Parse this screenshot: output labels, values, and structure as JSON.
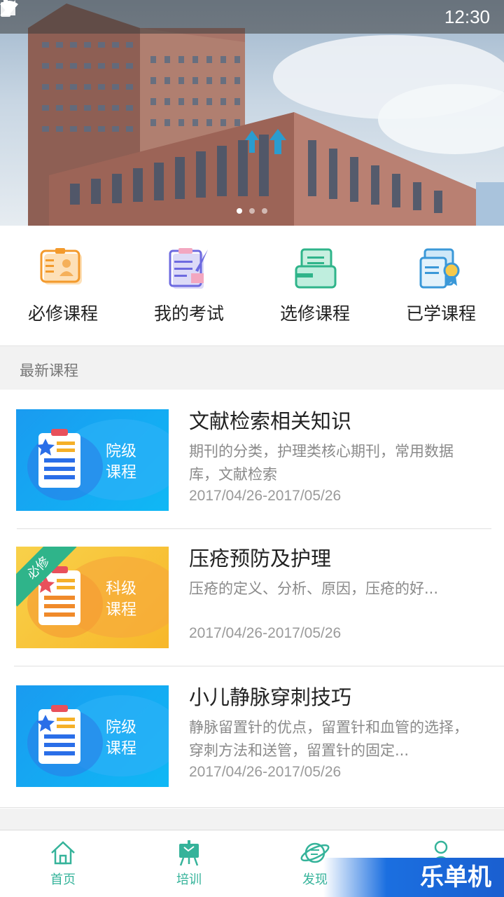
{
  "status_bar": {
    "time": "12:30"
  },
  "banner": {
    "slides": 3,
    "active_slide": 1
  },
  "quick_menu": [
    {
      "label": "必修课程",
      "icon": "required-course-icon"
    },
    {
      "label": "我的考试",
      "icon": "exam-icon"
    },
    {
      "label": "选修课程",
      "icon": "elective-course-icon"
    },
    {
      "label": "已学课程",
      "icon": "completed-course-icon"
    }
  ],
  "section": {
    "title": "最新课程"
  },
  "courses": [
    {
      "title": "文献检索相关知识",
      "desc": "期刊的分类，护理类核心期刊，常用数据库，文献检索",
      "date": "2017/04/26-2017/05/26",
      "level_line1": "院级",
      "level_line2": "课程",
      "theme": "blue",
      "tag": ""
    },
    {
      "title": "压疮预防及护理",
      "desc": "压疮的定义、分析、原因，压疮的好...",
      "date": "2017/04/26-2017/05/26",
      "level_line1": "科级",
      "level_line2": "课程",
      "theme": "yellow",
      "tag": "必修"
    },
    {
      "title": "小儿静脉穿刺技巧",
      "desc": "静脉留置针的优点，留置针和血管的选择，穿刺方法和送管，留置针的固定...",
      "date": "2017/04/26-2017/05/26",
      "level_line1": "院级",
      "level_line2": "课程",
      "theme": "blue",
      "tag": ""
    }
  ],
  "bottom_nav": [
    {
      "label": "首页",
      "icon": "home-icon"
    },
    {
      "label": "培训",
      "icon": "training-icon"
    },
    {
      "label": "发现",
      "icon": "discover-icon"
    },
    {
      "label": "",
      "icon": "profile-icon"
    }
  ],
  "watermark": {
    "text": "乐单机"
  },
  "colors": {
    "accent": "#35b39a",
    "blue_thumb": "#0fa0f0",
    "yellow_thumb": "#f7c531"
  }
}
